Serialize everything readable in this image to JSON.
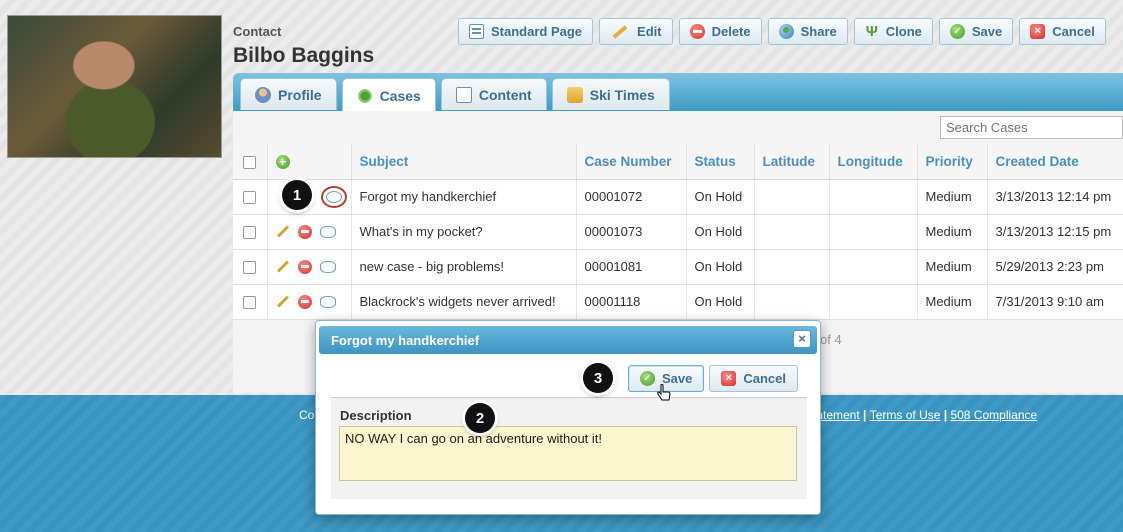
{
  "header": {
    "record_type": "Contact",
    "record_name": "Bilbo Baggins"
  },
  "toolbar": {
    "standard_page": "Standard Page",
    "edit": "Edit",
    "delete": "Delete",
    "share": "Share",
    "clone": "Clone",
    "save": "Save",
    "cancel": "Cancel"
  },
  "tabs": [
    {
      "label": "Profile",
      "icon": "profile-icon"
    },
    {
      "label": "Cases",
      "icon": "cases-icon",
      "active": true
    },
    {
      "label": "Content",
      "icon": "content-icon"
    },
    {
      "label": "Ski Times",
      "icon": "ski-times-icon"
    }
  ],
  "search": {
    "placeholder": "Search Cases"
  },
  "table": {
    "columns": [
      "Subject",
      "Case Number",
      "Status",
      "Latitude",
      "Longitude",
      "Priority",
      "Created Date"
    ],
    "rows": [
      {
        "subject": "Forgot my handkerchief",
        "case_number": "00001072",
        "status": "On Hold",
        "latitude": "",
        "longitude": "",
        "priority": "Medium",
        "created": "3/13/2013 12:14 pm"
      },
      {
        "subject": "What's in my pocket?",
        "case_number": "00001073",
        "status": "On Hold",
        "latitude": "",
        "longitude": "",
        "priority": "Medium",
        "created": "3/13/2013 12:15 pm"
      },
      {
        "subject": "new case - big problems!",
        "case_number": "00001081",
        "status": "On Hold",
        "latitude": "",
        "longitude": "",
        "priority": "Medium",
        "created": "5/29/2013 2:23 pm"
      },
      {
        "subject": "Blackrock's widgets never arrived!",
        "case_number": "00001118",
        "status": "On Hold",
        "latitude": "",
        "longitude": "",
        "priority": "Medium",
        "created": "7/31/2013 9:10 am"
      }
    ]
  },
  "pager": {
    "text": "of 4"
  },
  "dialog": {
    "title": "Forgot my handkerchief",
    "close": "×",
    "save": "Save",
    "cancel": "Cancel",
    "description_label": "Description",
    "description_value": "NO WAY I can go on an adventure without it!"
  },
  "steps": [
    "1",
    "2",
    "3"
  ],
  "footer": {
    "left": "Co",
    "link_statement": "tatement",
    "link_terms": "Terms of Use",
    "link_508": "508 Compliance",
    "separator": " | "
  },
  "colors": {
    "accent": "#3c9cc8",
    "link": "#4a90c0",
    "highlight_ring": "#c0392b",
    "textarea_bg": "#fbf6cf"
  }
}
